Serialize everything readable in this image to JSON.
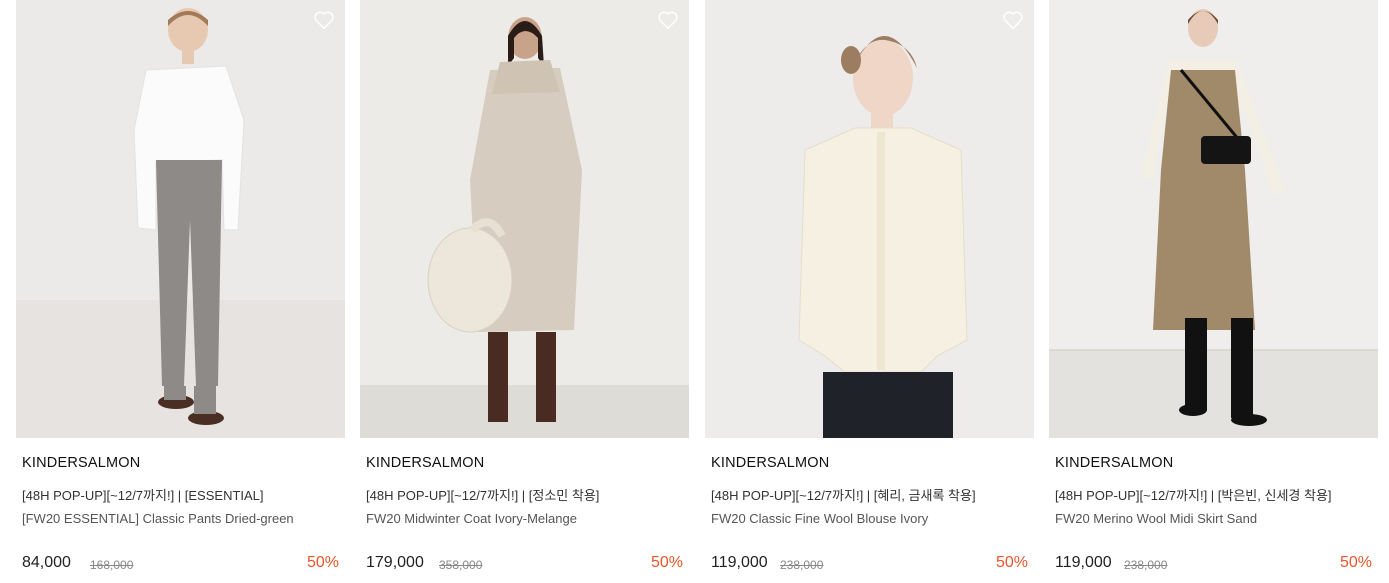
{
  "products": [
    {
      "brand": "KINDERSALMON",
      "promo": "[48H POP-UP][~12/7까지!] | [ESSENTIAL]",
      "name": "[FW20 ESSENTIAL] Classic Pants Dried-green",
      "price": "84,000",
      "original_price": "168,000",
      "discount": "50%"
    },
    {
      "brand": "KINDERSALMON",
      "promo": "[48H POP-UP][~12/7까지!] | [정소민 착용]",
      "name": "FW20 Midwinter Coat Ivory-Melange",
      "price": "179,000",
      "original_price": "358,000",
      "discount": "50%"
    },
    {
      "brand": "KINDERSALMON",
      "promo": "[48H POP-UP][~12/7까지!] | [혜리, 금새록 착용]",
      "name": "FW20 Classic Fine Wool Blouse Ivory",
      "price": "119,000",
      "original_price": "238,000",
      "discount": "50%"
    },
    {
      "brand": "KINDERSALMON",
      "promo": "[48H POP-UP][~12/7까지!] | [박은빈, 신세경 착용]",
      "name": "FW20 Merino Wool Midi Skirt Sand",
      "price": "119,000",
      "original_price": "238,000",
      "discount": "50%"
    }
  ],
  "colors": {
    "discount": "#e8552b",
    "text": "#222222",
    "muted": "#888888"
  },
  "icons": {
    "wishlist": "heart-outline-icon"
  }
}
